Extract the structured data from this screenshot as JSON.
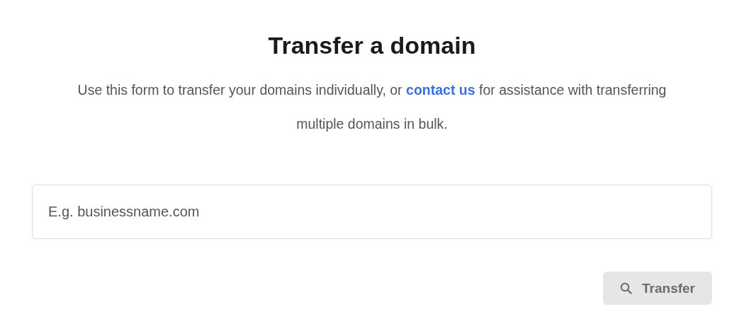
{
  "title": "Transfer a domain",
  "intro": {
    "before": "Use this form to transfer your domains individually, or ",
    "link": "contact us",
    "after": " for assistance with transferring multiple domains in bulk."
  },
  "domain_field": {
    "placeholder": "E.g. businessname.com"
  },
  "transfer_button": {
    "label": "Transfer",
    "disabled": true
  }
}
